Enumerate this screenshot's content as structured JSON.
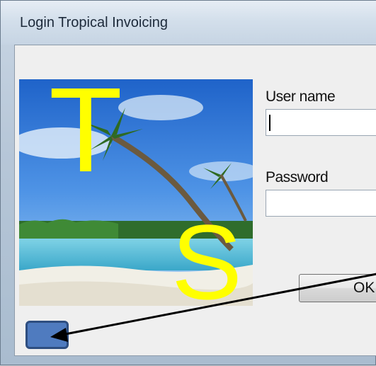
{
  "window": {
    "title": "Login Tropical Invoicing"
  },
  "logo": {
    "letters": [
      "T",
      "S"
    ],
    "letter_color": "#ffff00"
  },
  "form": {
    "username_label": "User name",
    "username_value": "",
    "password_label": "Password",
    "password_value": "",
    "ok_label": "OK"
  },
  "annotation": {
    "box_color": "#4f7bbf",
    "arrow_color": "#000000"
  }
}
